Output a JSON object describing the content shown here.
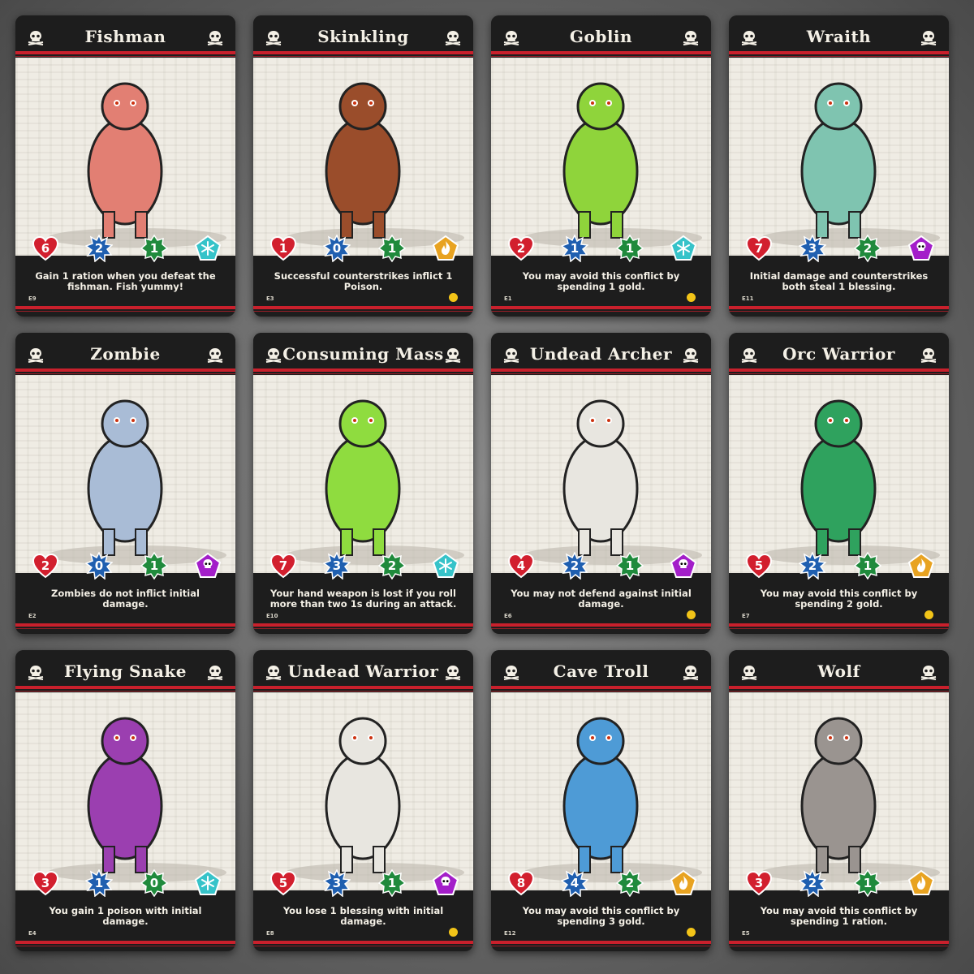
{
  "colors": {
    "heart": "#d21f2e",
    "defense": "#1f5fb0",
    "speed": "#1f8a3c",
    "ice": "#36c3c9",
    "fire": "#e8a321",
    "death": "#a31ec9",
    "accent_red": "#c9202c",
    "coin": "#f2c418"
  },
  "cards": [
    {
      "name": "Fishman",
      "health": "6",
      "defense": "2",
      "speed": "1",
      "type_icon": "snowflake-icon",
      "text": "Gain 1 ration when you defeat the fishman. Fish yummy!",
      "code": "E9",
      "coin": false,
      "art_color": "#e27f73"
    },
    {
      "name": "Skinkling",
      "health": "1",
      "defense": "0",
      "speed": "1",
      "type_icon": "fire-icon",
      "text": "Successful counterstrikes inflict 1 Poison.",
      "code": "E3",
      "coin": true,
      "art_color": "#9a4d2b"
    },
    {
      "name": "Goblin",
      "health": "2",
      "defense": "1",
      "speed": "1",
      "type_icon": "snowflake-icon",
      "text": "You may avoid this conflict by spending 1 gold.",
      "code": "E1",
      "coin": true,
      "art_color": "#8fd43b"
    },
    {
      "name": "Wraith",
      "health": "7",
      "defense": "3",
      "speed": "2",
      "type_icon": "skull-icon",
      "text": "Initial damage and counterstrikes both steal 1 blessing.",
      "code": "E11",
      "coin": false,
      "art_color": "#7fc4b0"
    },
    {
      "name": "Zombie",
      "health": "2",
      "defense": "0",
      "speed": "1",
      "type_icon": "skull-icon",
      "text": "Zombies do not inflict initial damage.",
      "code": "E2",
      "coin": false,
      "art_color": "#a9bcd6"
    },
    {
      "name": "Consuming Mass",
      "health": "7",
      "defense": "3",
      "speed": "2",
      "type_icon": "snowflake-icon",
      "text": "Your hand weapon is lost if you roll more than two 1s during an attack.",
      "code": "E10",
      "coin": false,
      "art_color": "#8fdc3f"
    },
    {
      "name": "Undead Archer",
      "health": "4",
      "defense": "2",
      "speed": "1",
      "type_icon": "skull-icon",
      "text": "You may not defend against initial damage.",
      "code": "E6",
      "coin": true,
      "art_color": "#e8e6e0"
    },
    {
      "name": "Orc Warrior",
      "health": "5",
      "defense": "2",
      "speed": "1",
      "type_icon": "fire-icon",
      "text": "You may avoid this conflict by spending 2 gold.",
      "code": "E7",
      "coin": true,
      "art_color": "#2fa25e"
    },
    {
      "name": "Flying Snake",
      "health": "3",
      "defense": "1",
      "speed": "0",
      "type_icon": "snowflake-icon",
      "text": "You gain 1 poison with initial damage.",
      "code": "E4",
      "coin": false,
      "art_color": "#9b3fb0"
    },
    {
      "name": "Undead Warrior",
      "health": "5",
      "defense": "3",
      "speed": "1",
      "type_icon": "skull-icon",
      "text": "You lose 1 blessing with initial damage.",
      "code": "E8",
      "coin": true,
      "art_color": "#e8e6e0"
    },
    {
      "name": "Cave Troll",
      "health": "8",
      "defense": "4",
      "speed": "2",
      "type_icon": "fire-icon",
      "text": "You may avoid this conflict by spending 3 gold.",
      "code": "E12",
      "coin": true,
      "art_color": "#4e9bd6"
    },
    {
      "name": "Wolf",
      "health": "3",
      "defense": "2",
      "speed": "1",
      "type_icon": "fire-icon",
      "text": "You may avoid this conflict by spending 1 ration.",
      "code": "E5",
      "coin": false,
      "art_color": "#9a9490"
    }
  ]
}
